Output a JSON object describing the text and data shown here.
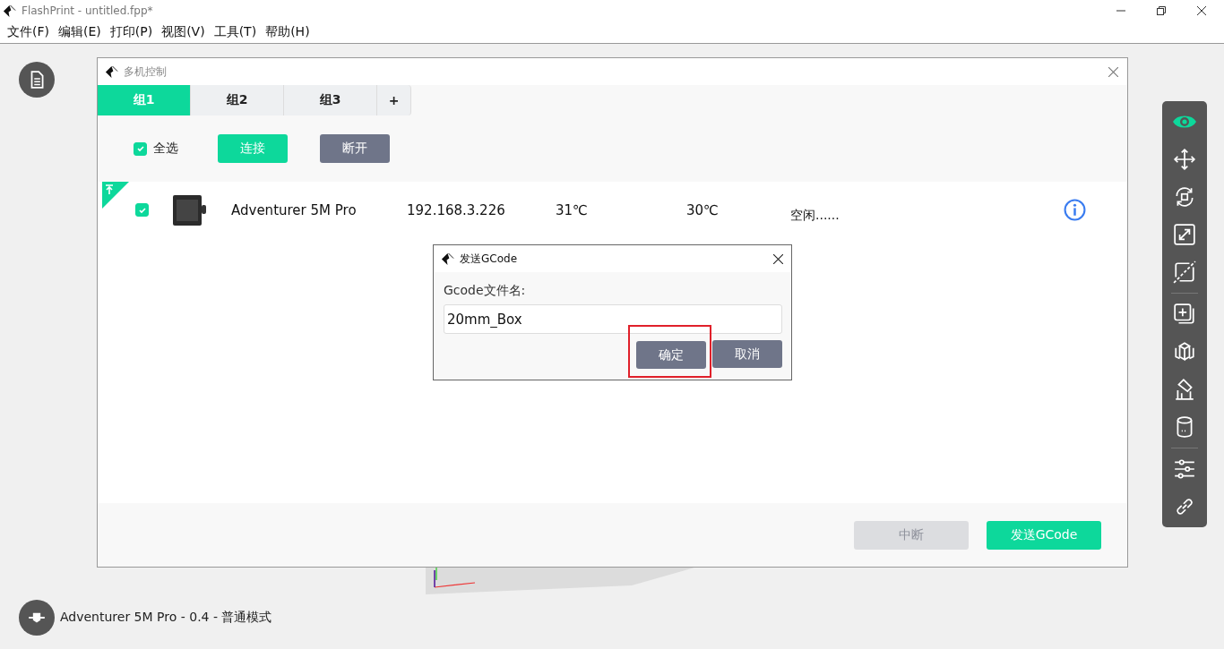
{
  "window": {
    "title": "FlashPrint - untitled.fpp*"
  },
  "menu": [
    "文件(F)",
    "编辑(E)",
    "打印(P)",
    "视图(V)",
    "工具(T)",
    "帮助(H)"
  ],
  "toolbar": [
    [
      {
        "kind": "view",
        "selected": true
      },
      {
        "kind": "move",
        "selected": false
      },
      {
        "kind": "rotate",
        "selected": false
      },
      {
        "kind": "scale",
        "selected": false
      },
      {
        "kind": "cut",
        "selected": false
      }
    ],
    [
      {
        "kind": "add",
        "selected": false
      },
      {
        "kind": "split",
        "selected": false
      },
      {
        "kind": "support",
        "selected": false
      },
      {
        "kind": "hollow",
        "selected": false
      }
    ],
    [
      {
        "kind": "settings",
        "selected": false
      },
      {
        "kind": "link",
        "selected": false
      }
    ]
  ],
  "printer_status": "Adventurer 5M Pro - 0.4 - 普通模式",
  "multi_control": {
    "title": "多机控制",
    "tabs": [
      {
        "label": "组1",
        "selected": true
      },
      {
        "label": "组2",
        "selected": false
      },
      {
        "label": "组3",
        "selected": false
      },
      {
        "label": "+",
        "selected": false
      }
    ],
    "select_all": {
      "label": "全选",
      "checked": true
    },
    "connect": "连接",
    "disconnect": "断开",
    "printers": [
      {
        "checked": true,
        "pinned": true,
        "name": "Adventurer 5M Pro",
        "ip": "192.168.3.226",
        "temp_1": "31℃",
        "temp_2": "30℃",
        "status": "空闲......"
      }
    ],
    "abort": {
      "label": "中断",
      "disabled": true
    },
    "send": "发送GCode"
  },
  "send_dialog": {
    "title": "发送GCode",
    "label": "Gcode文件名:",
    "value": "20mm_Box",
    "ok": {
      "label": "确定",
      "highlighted": true
    },
    "cancel": "取消"
  }
}
